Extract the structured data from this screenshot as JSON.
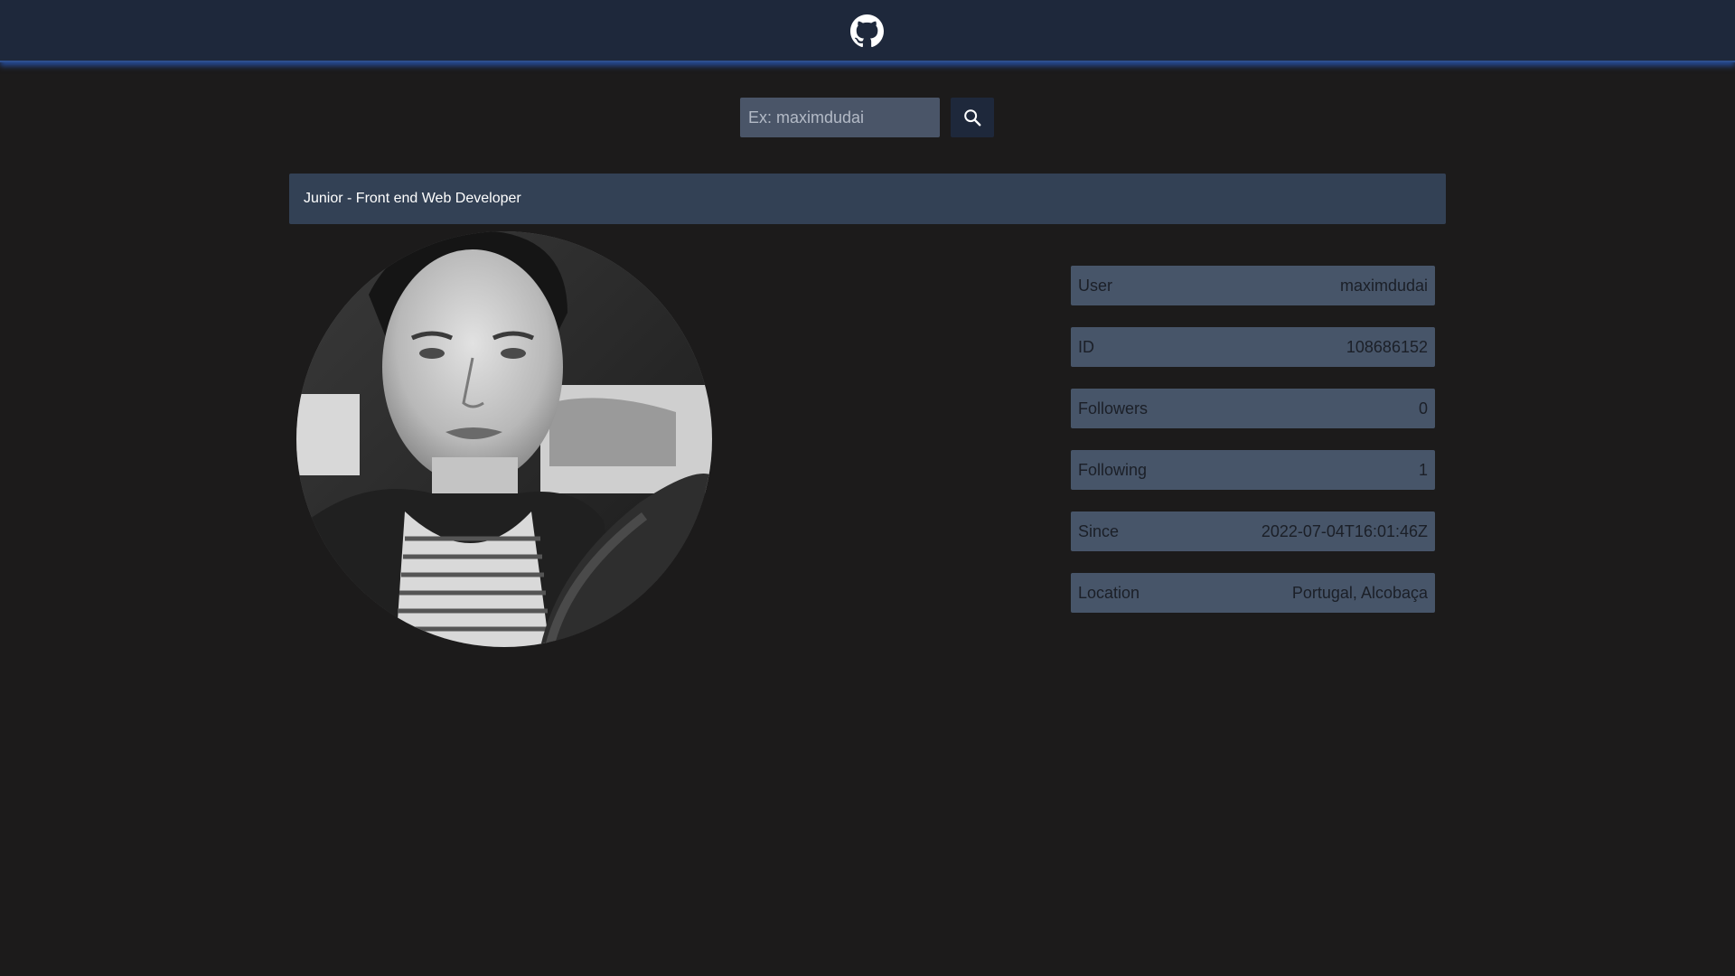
{
  "header": {
    "logo_icon": "github-icon"
  },
  "search": {
    "placeholder": "Ex: maximdudai",
    "value": "",
    "button_icon": "search-icon"
  },
  "profile": {
    "bio": "Junior - Front end Web Developer",
    "avatar_icon": "profile-photo"
  },
  "info": [
    {
      "label": "User",
      "value": "maximdudai"
    },
    {
      "label": "ID",
      "value": "108686152"
    },
    {
      "label": "Followers",
      "value": "0"
    },
    {
      "label": "Following",
      "value": "1"
    },
    {
      "label": "Since",
      "value": "2022-07-04T16:01:46Z"
    },
    {
      "label": "Location",
      "value": "Portugal, Alcobaça"
    }
  ],
  "colors": {
    "page_background": "#1c1b1b",
    "header_background": "#1e283b",
    "header_glow": "#2d4f8e",
    "bio_bar": "#334155",
    "info_row": "#475569",
    "search_input": "#4a5568"
  }
}
